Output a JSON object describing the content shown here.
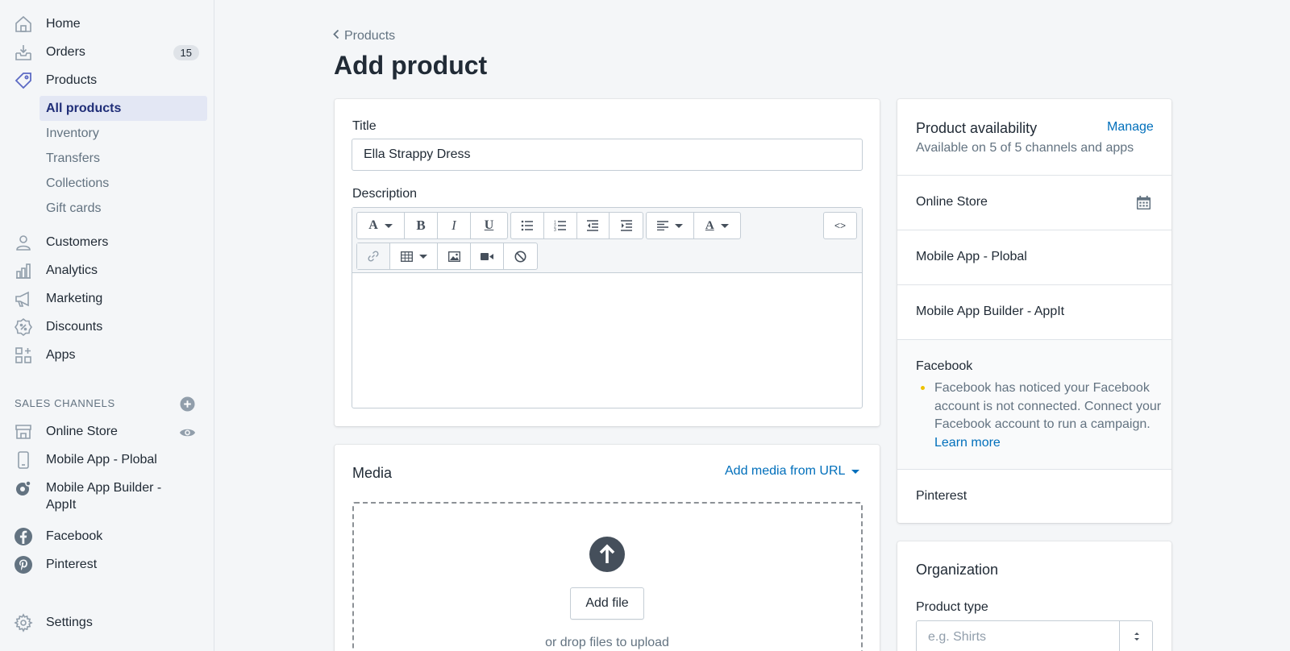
{
  "sidebar": {
    "nav": [
      {
        "label": "Home",
        "icon": "home-icon"
      },
      {
        "label": "Orders",
        "icon": "orders-icon",
        "badge": "15"
      },
      {
        "label": "Products",
        "icon": "tag-icon"
      }
    ],
    "products_sub": [
      "All products",
      "Inventory",
      "Transfers",
      "Collections",
      "Gift cards"
    ],
    "nav2": [
      {
        "label": "Customers",
        "icon": "customers-icon"
      },
      {
        "label": "Analytics",
        "icon": "analytics-icon"
      },
      {
        "label": "Marketing",
        "icon": "megaphone-icon"
      },
      {
        "label": "Discounts",
        "icon": "discount-icon"
      },
      {
        "label": "Apps",
        "icon": "apps-icon"
      }
    ],
    "sales_channels_heading": "SALES CHANNELS",
    "channels": [
      {
        "label": "Online Store",
        "icon": "store-icon"
      },
      {
        "label": "Mobile App - Plobal",
        "icon": "mobile-icon"
      },
      {
        "label_line1": "Mobile App Builder -",
        "label_line2": "AppIt",
        "icon": "appit-icon"
      },
      {
        "label": "Facebook",
        "icon": "facebook-icon"
      },
      {
        "label": "Pinterest",
        "icon": "pinterest-icon"
      }
    ],
    "settings": "Settings"
  },
  "main": {
    "breadcrumb": "Products",
    "title": "Add product",
    "title_field_label": "Title",
    "title_value": "Ella Strappy Dress",
    "description_label": "Description",
    "code_btn": "<>",
    "media": {
      "title": "Media",
      "add_from_url": "Add media from URL",
      "add_file": "Add file",
      "drop_hint": "or drop files to upload"
    }
  },
  "availability": {
    "title": "Product availability",
    "subtitle": "Available on 5 of 5 channels and apps",
    "manage": "Manage",
    "channels": [
      "Online Store",
      "Mobile App - Plobal",
      "Mobile App Builder - AppIt",
      "Facebook",
      "Pinterest"
    ],
    "facebook_note": "Facebook has noticed your Facebook account is not connected. Connect your Facebook account to run a campaign.",
    "learn_more": "Learn more"
  },
  "organization": {
    "title": "Organization",
    "product_type_label": "Product type",
    "product_type_placeholder": "e.g. Shirts"
  },
  "colors": {
    "link": "#006fbb",
    "active_bg": "#e3e7f4",
    "active_text": "#202e78",
    "warning_dot": "#eec200"
  }
}
